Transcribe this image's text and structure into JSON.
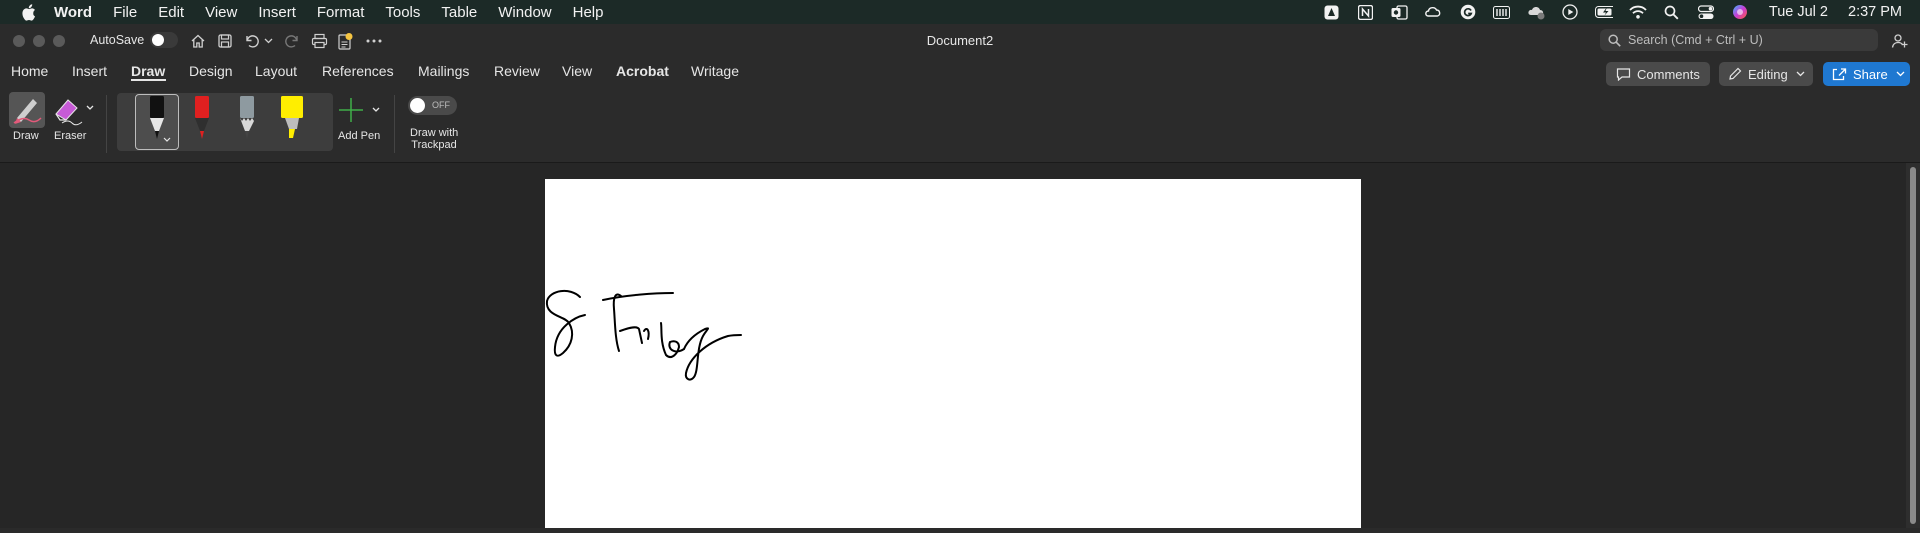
{
  "menubar": {
    "app": "Word",
    "items": [
      "File",
      "Edit",
      "View",
      "Insert",
      "Format",
      "Tools",
      "Table",
      "Window",
      "Help"
    ],
    "date": "Tue Jul 2",
    "time": "2:37 PM"
  },
  "titlebar": {
    "autosave_label": "AutoSave",
    "autosave_on": false,
    "document_title": "Document2",
    "search_placeholder": "Search (Cmd + Ctrl + U)"
  },
  "tabs": [
    {
      "label": "Home",
      "active": false
    },
    {
      "label": "Insert",
      "active": false
    },
    {
      "label": "Draw",
      "active": true
    },
    {
      "label": "Design",
      "active": false
    },
    {
      "label": "Layout",
      "active": false
    },
    {
      "label": "References",
      "active": false
    },
    {
      "label": "Mailings",
      "active": false
    },
    {
      "label": "Review",
      "active": false
    },
    {
      "label": "View",
      "active": false
    },
    {
      "label": "Acrobat",
      "active": false
    },
    {
      "label": "Writage",
      "active": false
    }
  ],
  "actions": {
    "comments_label": "Comments",
    "editing_label": "Editing",
    "share_label": "Share"
  },
  "ribbon": {
    "draw_label": "Draw",
    "eraser_label": "Eraser",
    "add_pen_label": "Add Pen",
    "draw_with_trackpad_label_line1": "Draw with",
    "draw_with_trackpad_label_line2": "Trackpad",
    "trackpad_toggle_state": "OFF",
    "pens": [
      {
        "name": "black-pen",
        "color": "#111111",
        "selected": true
      },
      {
        "name": "red-pen",
        "color": "#e02020",
        "selected": false
      },
      {
        "name": "gray-pencil",
        "color": "#8e9aa0",
        "selected": false
      },
      {
        "name": "yellow-highlighter",
        "color": "#ffee00",
        "selected": false
      }
    ]
  },
  "colors": {
    "accent": "#1f78d1",
    "menubar_bg": "#1c2a27",
    "window_bg": "#2b2b2b",
    "page": "#ffffff"
  }
}
